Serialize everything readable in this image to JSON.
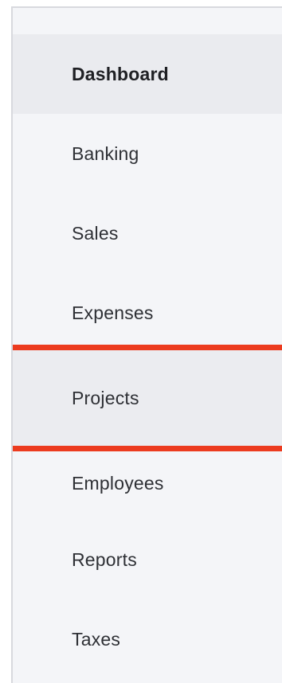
{
  "sidebar": {
    "items": [
      {
        "label": "Dashboard"
      },
      {
        "label": "Banking"
      },
      {
        "label": "Sales"
      },
      {
        "label": "Expenses"
      },
      {
        "label": "Projects"
      },
      {
        "label": "Employees"
      },
      {
        "label": "Reports"
      },
      {
        "label": "Taxes"
      }
    ],
    "selected_index": 0,
    "highlighted_index": 4,
    "highlight_color": "#ec3b1f"
  }
}
